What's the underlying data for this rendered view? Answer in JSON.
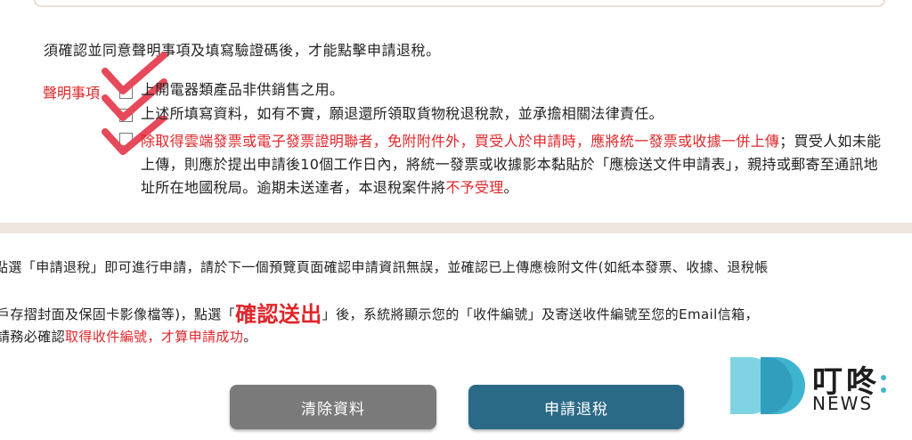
{
  "instruction": "須確認並同意聲明事項及填寫驗證碼後，才能點擊申請退稅。",
  "declaration_label": "聲明事項",
  "declarations": [
    {
      "text": "上開電器類產品非供銷售之用。",
      "checked": true
    },
    {
      "text": "上述所填寫資料，如有不實，願退還所領取貨物稅退稅款，並承擔相關法律責任。",
      "checked": true
    },
    {
      "checked": true,
      "red_part": "除取得雲端發票或電子發票證明聯者，免附附件外，買受人於申請時，應將統一發票或收據一併上傳",
      "normal_part": "；買受人如未能上傳，則應於提出申請後10個工作日內，將統一發票或收據影本黏貼於「應檢送文件申請表」，親持或郵寄至通訊地址所在地國稅局。逾期未送達者，本退稅案件將",
      "red_end": "不予受理",
      "end": "。"
    }
  ],
  "notice": {
    "line1": "點選「申請退稅」即可進行申請，請於下一個預覽頁面確認申請資訊無誤，並確認已上傳應檢附文件(如紙本發票、收據、退稅帳",
    "line2_a": "戶存摺封面及保固卡影像檔等)，點選「",
    "line2_red": "確認送出",
    "line2_b": "」後，系統將顯示您的「收件編號」及寄送收件編號至您的Email信箱，",
    "line3_a": "請務必確認",
    "line3_red": "取得收件編號，才算申請成功",
    "line3_b": "。"
  },
  "buttons": {
    "clear": "清除資料",
    "apply": "申請退稅"
  },
  "logo": {
    "zh": "叮咚",
    "en": "NEWS"
  },
  "colors": {
    "accent_red": "#e0262a",
    "apply_button": "#2b6a87",
    "clear_button": "#7a7a7a",
    "logo_teal": "#3fb4cf"
  }
}
